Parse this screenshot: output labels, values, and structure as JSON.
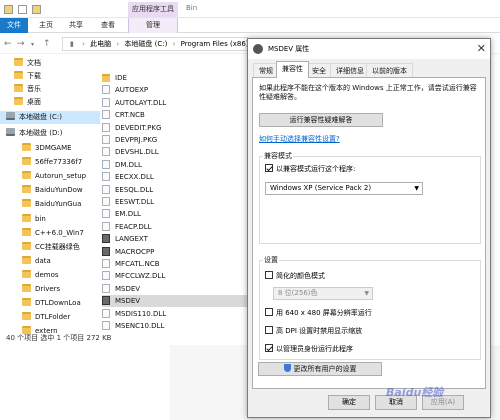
{
  "explorer": {
    "context_group": "应用程序工具",
    "window_title": "Bin",
    "tabs": [
      "文件",
      "主页",
      "共享",
      "查看",
      "管理"
    ],
    "address": [
      "此电脑",
      "本地磁盘 (C:)",
      "Program Files (x86)"
    ],
    "nav_items": [
      {
        "label": "文档",
        "type": "folder"
      },
      {
        "label": "下载",
        "type": "folder"
      },
      {
        "label": "音乐",
        "type": "folder"
      },
      {
        "label": "桌面",
        "type": "folder"
      },
      {
        "label": "本地磁盘 (C:)",
        "type": "drive"
      },
      {
        "label": "本地磁盘 (D:)",
        "type": "drive"
      },
      {
        "label": "3DMGAME",
        "type": "folder"
      },
      {
        "label": "56ffe77336f7",
        "type": "folder"
      },
      {
        "label": "Autorun_setup",
        "type": "folder"
      },
      {
        "label": "BaiduYunDow",
        "type": "folder"
      },
      {
        "label": "BaiduYunGua",
        "type": "folder"
      },
      {
        "label": "bin",
        "type": "folder"
      },
      {
        "label": "C++6.0_Win7",
        "type": "folder"
      },
      {
        "label": "CC挂载器绿色",
        "type": "folder"
      },
      {
        "label": "data",
        "type": "folder"
      },
      {
        "label": "demos",
        "type": "folder"
      },
      {
        "label": "Drivers",
        "type": "folder"
      },
      {
        "label": "DTLDownLoa",
        "type": "folder"
      },
      {
        "label": "DTLFolder",
        "type": "folder"
      },
      {
        "label": "extern",
        "type": "folder"
      }
    ],
    "files": [
      {
        "name": "IDE",
        "type": "folder"
      },
      {
        "name": "AUTOEXP",
        "type": "file"
      },
      {
        "name": "AUTOLAYT.DLL",
        "type": "file"
      },
      {
        "name": "CRT.NCB",
        "type": "file"
      },
      {
        "name": "DEVEDIT.PKG",
        "type": "file"
      },
      {
        "name": "DEVPRJ.PKG",
        "type": "file"
      },
      {
        "name": "DEVSHL.DLL",
        "type": "file"
      },
      {
        "name": "DM.DLL",
        "type": "file"
      },
      {
        "name": "EECXX.DLL",
        "type": "file"
      },
      {
        "name": "EESQL.DLL",
        "type": "file"
      },
      {
        "name": "EESWT.DLL",
        "type": "file"
      },
      {
        "name": "EM.DLL",
        "type": "file"
      },
      {
        "name": "FEACP.DLL",
        "type": "file"
      },
      {
        "name": "LANGEXT",
        "type": "app"
      },
      {
        "name": "MACROCPP",
        "type": "app"
      },
      {
        "name": "MFCATL.NCB",
        "type": "file"
      },
      {
        "name": "MFCCLWZ.DLL",
        "type": "file"
      },
      {
        "name": "MSDEV",
        "type": "file"
      },
      {
        "name": "MSDEV",
        "type": "app"
      },
      {
        "name": "MSDIS110.DLL",
        "type": "file"
      },
      {
        "name": "MSENC10.DLL",
        "type": "file"
      }
    ],
    "status": "40 个项目    选中 1 个项目  272 KB"
  },
  "dialog": {
    "title": "MSDEV 属性",
    "tabs": [
      "常规",
      "兼容性",
      "安全",
      "详细信息",
      "以前的版本"
    ],
    "active_tab": 1,
    "intro": "如果此程序不能在这个版本的 Windows 上正常工作，请尝试运行兼容性疑难解答。",
    "troubleshoot_btn": "运行兼容性疑难解答",
    "manual_link": "如何手动选择兼容性设置?",
    "compat_mode": {
      "group_label": "兼容模式",
      "checkbox": "以兼容模式运行这个程序:",
      "checked": true,
      "os_value": "Windows XP (Service Pack 2)"
    },
    "settings": {
      "group_label": "设置",
      "reduced_color": "简化的颜色模式",
      "color_value": "8 位(256)色",
      "res_640": "用 640 x 480 屏幕分辨率运行",
      "high_dpi": "高 DPI 设置时禁用显示缩放",
      "admin": "以管理员身份运行此程序"
    },
    "all_users_btn": "更改所有用户的设置",
    "ok": "确定",
    "cancel": "取消",
    "apply": "应用(A)"
  },
  "watermark": "Baidu经验"
}
